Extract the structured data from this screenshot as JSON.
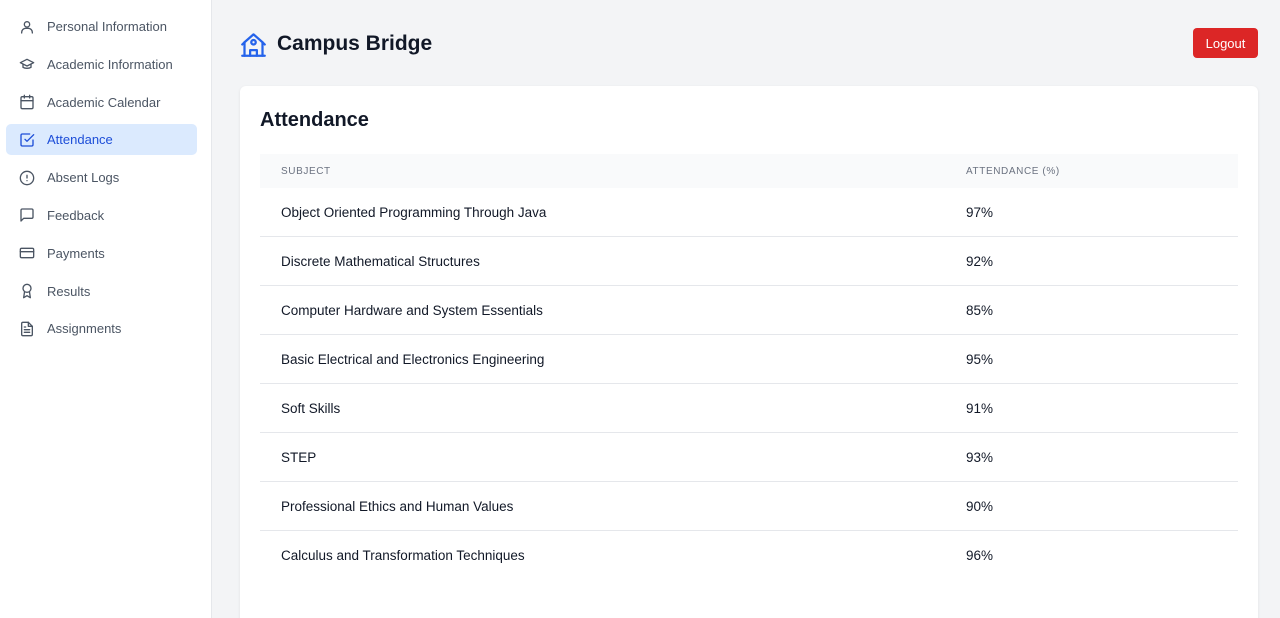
{
  "sidebar": {
    "items": [
      {
        "label": "Personal Information",
        "icon": "user-icon"
      },
      {
        "label": "Academic Information",
        "icon": "graduation-cap-icon"
      },
      {
        "label": "Academic Calendar",
        "icon": "calendar-icon"
      },
      {
        "label": "Attendance",
        "icon": "check-square-icon",
        "active": true
      },
      {
        "label": "Absent Logs",
        "icon": "alert-circle-icon"
      },
      {
        "label": "Feedback",
        "icon": "message-square-icon"
      },
      {
        "label": "Payments",
        "icon": "credit-card-icon"
      },
      {
        "label": "Results",
        "icon": "award-icon"
      },
      {
        "label": "Assignments",
        "icon": "file-text-icon"
      }
    ]
  },
  "header": {
    "app_title": "Campus Bridge",
    "logo_icon": "school-icon",
    "logout_label": "Logout"
  },
  "attendance": {
    "title": "Attendance",
    "columns": [
      "SUBJECT",
      "ATTENDANCE (%)"
    ],
    "rows": [
      {
        "subject": "Object Oriented Programming Through Java",
        "attendance": "97%"
      },
      {
        "subject": "Discrete Mathematical Structures",
        "attendance": "92%"
      },
      {
        "subject": "Computer Hardware and System Essentials",
        "attendance": "85%"
      },
      {
        "subject": "Basic Electrical and Electronics Engineering",
        "attendance": "95%"
      },
      {
        "subject": "Soft Skills",
        "attendance": "91%"
      },
      {
        "subject": "STEP",
        "attendance": "93%"
      },
      {
        "subject": "Professional Ethics and Human Values",
        "attendance": "90%"
      },
      {
        "subject": "Calculus and Transformation Techniques",
        "attendance": "96%"
      }
    ]
  },
  "colors": {
    "accent": "#2563eb",
    "active_bg": "#dbeafe",
    "logout": "#dc2626"
  }
}
